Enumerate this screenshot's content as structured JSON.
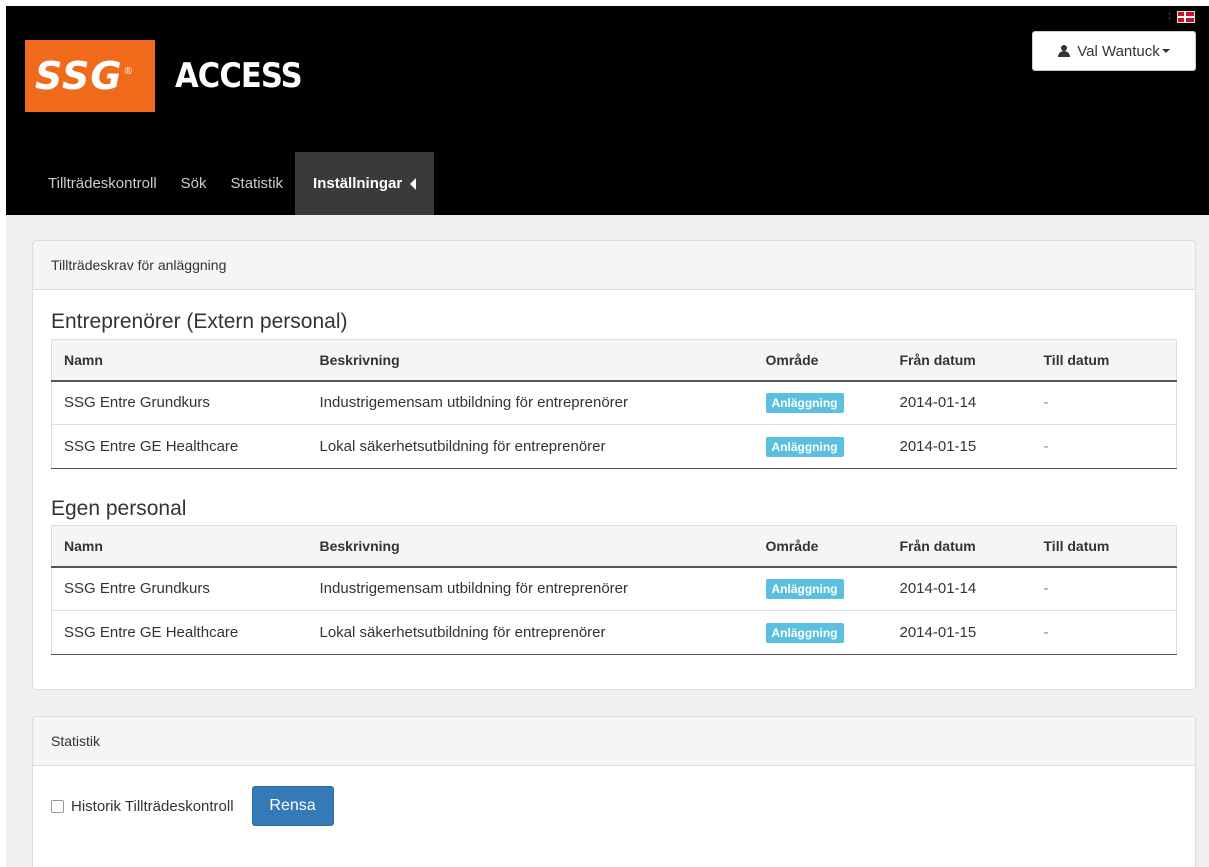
{
  "header": {
    "logo_text": "SSG",
    "logo_reg": "®",
    "app_name": "ACCESS",
    "flag_separator": ":",
    "user_name": "Val Wantuck"
  },
  "nav": {
    "items": [
      {
        "label": "Tillträdeskontroll"
      },
      {
        "label": "Sök"
      },
      {
        "label": "Statistik"
      },
      {
        "label": "Inställningar",
        "active": true
      }
    ]
  },
  "access_panel": {
    "heading": "Tillträdeskrav för anläggning",
    "columns": [
      "Namn",
      "Beskrivning",
      "Område",
      "Från datum",
      "Till datum"
    ],
    "sections": [
      {
        "title": "Entreprenörer (Extern personal)",
        "rows": [
          {
            "name": "SSG Entre Grundkurs",
            "description": "Industrigemensam utbildning för entreprenörer",
            "area": "Anläggning",
            "from": "2014-01-14",
            "to": "-"
          },
          {
            "name": "SSG Entre GE Healthcare",
            "description": "Lokal säkerhetsutbildning för entreprenörer",
            "area": "Anläggning",
            "from": "2014-01-15",
            "to": "-"
          }
        ]
      },
      {
        "title": "Egen personal",
        "rows": [
          {
            "name": "SSG Entre Grundkurs",
            "description": "Industrigemensam utbildning för entreprenörer",
            "area": "Anläggning",
            "from": "2014-01-14",
            "to": "-"
          },
          {
            "name": "SSG Entre GE Healthcare",
            "description": "Lokal säkerhetsutbildning för entreprenörer",
            "area": "Anläggning",
            "from": "2014-01-15",
            "to": "-"
          }
        ]
      }
    ]
  },
  "stats_panel": {
    "heading": "Statistik",
    "checkbox_label": "Historik Tillträdeskontroll",
    "checkbox_checked": false,
    "clear_button": "Rensa"
  },
  "colors": {
    "brand_orange": "#ef6b1b",
    "badge": "#5bc0de",
    "primary": "#337ab7"
  }
}
